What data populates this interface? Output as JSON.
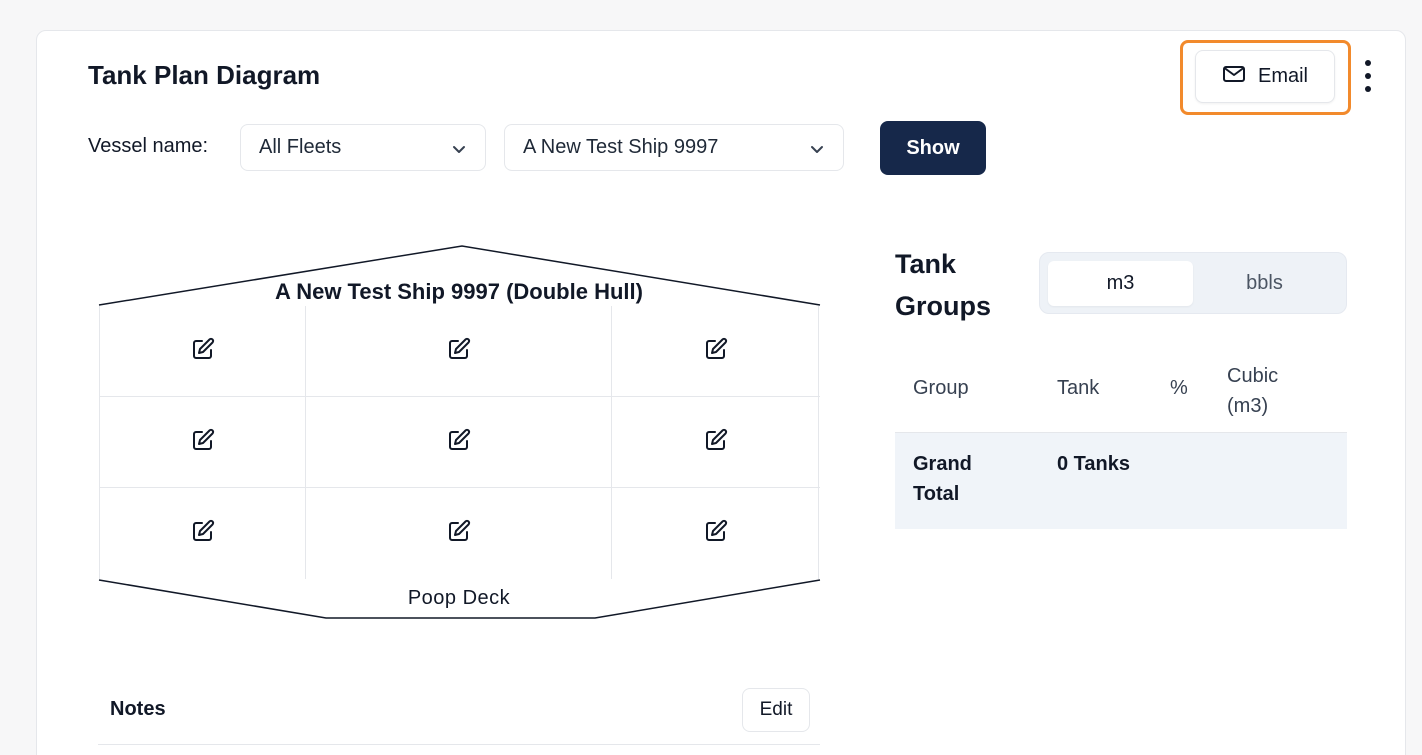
{
  "header": {
    "title": "Tank Plan Diagram",
    "email_label": "Email"
  },
  "filters": {
    "vessel_label": "Vessel name:",
    "fleet_value": "All Fleets",
    "ship_value": "A New Test Ship 9997",
    "show_label": "Show"
  },
  "diagram": {
    "ship_name": "A New Test Ship 9997 (Double Hull)",
    "stern_label": "Poop Deck",
    "cells": [
      {
        "icon": "edit-icon"
      },
      {
        "icon": "edit-icon"
      },
      {
        "icon": "edit-icon"
      },
      {
        "icon": "edit-icon"
      },
      {
        "icon": "edit-icon"
      },
      {
        "icon": "edit-icon"
      },
      {
        "icon": "edit-icon"
      },
      {
        "icon": "edit-icon"
      },
      {
        "icon": "edit-icon"
      }
    ]
  },
  "tank_groups": {
    "title": "Tank Groups",
    "units": [
      "m3",
      "bbls"
    ],
    "selected_unit": "m3",
    "columns": [
      "Group",
      "Tank",
      "%",
      "Cubic (m3)"
    ],
    "total_row": {
      "group": "Grand Total",
      "tank": "0 Tanks",
      "percent": "",
      "cubic": ""
    }
  },
  "notes": {
    "label": "Notes",
    "edit_label": "Edit"
  },
  "colors": {
    "primary": "#16284a",
    "highlight": "#f28a2c",
    "table_total_bg": "#f0f4f9"
  }
}
